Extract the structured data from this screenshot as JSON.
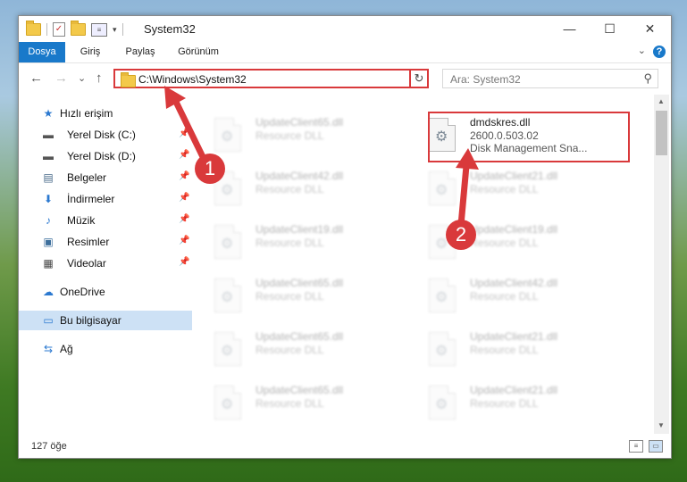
{
  "window": {
    "title": "System32",
    "minimize": "—",
    "maximize": "☐",
    "close": "✕"
  },
  "ribbon": {
    "tabs": [
      "Dosya",
      "Giriş",
      "Paylaş",
      "Görünüm"
    ],
    "help": "?",
    "expand": "⌄"
  },
  "nav": {
    "back": "←",
    "forward": "→",
    "recent": "⌄",
    "up": "↑",
    "address": "C:\\Windows\\System32",
    "address_dropdown": "⌄",
    "refresh": "↻",
    "search_placeholder": "Ara: System32",
    "search_icon": "⚲"
  },
  "sidebar": {
    "items": [
      {
        "label": "Hızlı erişim",
        "icon": "★",
        "pinned": false,
        "top": true
      },
      {
        "label": "Yerel Disk (C:)",
        "icon": "▬",
        "pinned": true,
        "top": false
      },
      {
        "label": "Yerel Disk (D:)",
        "icon": "▬",
        "pinned": true,
        "top": false
      },
      {
        "label": "Belgeler",
        "icon": "▤",
        "pinned": true,
        "top": false
      },
      {
        "label": "İndirmeler",
        "icon": "⬇",
        "pinned": true,
        "top": false
      },
      {
        "label": "Müzik",
        "icon": "♪",
        "pinned": true,
        "top": false
      },
      {
        "label": "Resimler",
        "icon": "▣",
        "pinned": true,
        "top": false
      },
      {
        "label": "Videolar",
        "icon": "▦",
        "pinned": true,
        "top": false
      },
      {
        "label": "OneDrive",
        "icon": "☁",
        "pinned": false,
        "top": true
      },
      {
        "label": "Bu bilgisayar",
        "icon": "▭",
        "pinned": false,
        "top": true,
        "selected": true
      },
      {
        "label": "Ağ",
        "icon": "⇆",
        "pinned": false,
        "top": true
      }
    ],
    "pin_icon": "📌"
  },
  "files": [
    {
      "name": "UpdateClient65.dll",
      "type": "Resource DLL"
    },
    {
      "name": "dmdskres.dll",
      "version": "2600.0.503.02",
      "desc": "Disk Management Sna..."
    },
    {
      "name": "UpdateClient42.dll",
      "type": "Resource DLL"
    },
    {
      "name": "UpdateClient21.dll",
      "type": "Resource DLL"
    },
    {
      "name": "UpdateClient19.dll",
      "type": "Resource DLL"
    },
    {
      "name": "UpdateClient19.dll",
      "type": "Resource DLL"
    },
    {
      "name": "UpdateClient65.dll",
      "type": "Resource DLL"
    },
    {
      "name": "UpdateClient42.dll",
      "type": "Resource DLL"
    },
    {
      "name": "UpdateClient65.dll",
      "type": "Resource DLL"
    },
    {
      "name": "UpdateClient21.dll",
      "type": "Resource DLL"
    },
    {
      "name": "UpdateClient65.dll",
      "type": "Resource DLL"
    },
    {
      "name": "UpdateClient21.dll",
      "type": "Resource DLL"
    }
  ],
  "status": {
    "count": "127 öğe"
  },
  "annotations": {
    "badge1": "1",
    "badge2": "2"
  },
  "colors": {
    "accent": "#1979ca",
    "highlight": "#d9393b",
    "selected": "#cde1f5"
  }
}
